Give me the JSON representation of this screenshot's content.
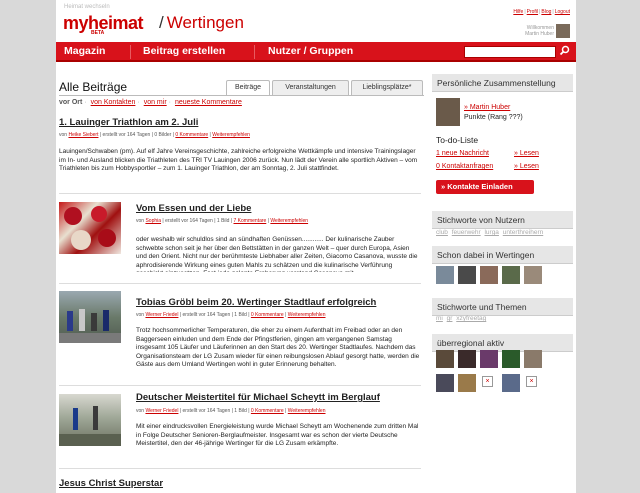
{
  "header": {
    "heimat_switch": "Heimat wechseln",
    "logo": "myheimat",
    "beta": "BETA",
    "city": "Wertingen",
    "toplinks": [
      "Hilfe",
      "Profil",
      "Blog",
      "Logout"
    ],
    "welcome_line1": "Willkommen",
    "welcome_line2": "Martin Huber"
  },
  "nav": {
    "items": [
      "Magazin",
      "Beitrag erstellen",
      "Nutzer / Gruppen"
    ],
    "search_placeholder": ""
  },
  "main": {
    "title": "Alle Beiträge",
    "tabs": [
      "Beiträge",
      "Veranstaltungen",
      "Lieblingsplätze*"
    ],
    "subnav": {
      "current": "vor Ort",
      "links": [
        "von Kontakten",
        "von mir",
        "neueste Kommentare"
      ]
    },
    "articles": [
      {
        "title": "1. Lauinger Triathlon am 2. Juli",
        "meta_pre": "von",
        "author": "Heike Siebert",
        "meta_mid": "| erstellt vor 164 Tagen | 0 Bilder |",
        "comments": "0 Kommentare",
        "recommend": "Weiterempfehlen",
        "text": "Lauingen/Schwaben (pm). Auf elf Jahre Vereinsgeschichte, zahlreiche erfolgreiche Wettkämpfe und intensive Trainingslager im In- und Ausland blicken die Triathleten des TRI TV Lauingen 2006 zurück. Nun lädt der Verein alle sportlich Aktiven – vom Triathleten bis zum Hobbysportler – zum 1. Lauinger Triathlon, der am Sonntag, 2. Juli stattfindet."
      },
      {
        "title": "Vom Essen und der Liebe",
        "meta_pre": "von",
        "author": "Sophia",
        "meta_mid": "| erstellt vor 164 Tagen | 1 Bild |",
        "comments": "7 Kommentare",
        "recommend": "Weiterempfehlen",
        "text": "oder weshalb wir schuldlos sind an sündhaften Genüssen............ Der kulinarische Zauber schwebte schon seit je her über den Bettstätten in der ganzen Welt – quer durch Europa, Asien und den Orient. Nicht nur der berühmteste Liebhaber aller Zeiten, Giacomo Casanova, wusste die aphrodisierende Wirkung eines guten Mahls zu schätzen und die kulinarische Verführung geschickt einzusetzen. Fast jede galante Eroberung verstand Casanova mit ..."
      },
      {
        "title": "Tobias Gröbl beim 20. Wertinger Stadtlauf erfolgreich",
        "meta_pre": "von",
        "author": "Werner Friedel",
        "meta_mid": "| erstellt vor 164 Tagen | 1 Bild |",
        "comments": "0 Kommentare",
        "recommend": "Weiterempfehlen",
        "text": "Trotz hochsommerlicher Temperaturen, die eher zu einem Aufenthalt im Freibad oder an den Baggerseen einluden und dem Ende der Pfingstferien, gingen am vergangenen Samstag insgesamt 105 Läufer und Läuferinnen an den Start des 20. Wertinger Stadtlaufes. Nachdem das Organisationsteam der LG Zusam wieder für einen reibungslosen Ablauf gesorgt hatte, werden die Gäste aus dem Umland Wertingen wohl in guter Erinnerung behalten."
      },
      {
        "title": "Deutscher Meistertitel für Michael Scheytt im Berglauf",
        "meta_pre": "von",
        "author": "Werner Friedel",
        "meta_mid": "| erstellt vor 164 Tagen | 1 Bild |",
        "comments": "0 Kommentare",
        "recommend": "Weiterempfehlen",
        "text": "Mit einer eindrucksvollen Energieleistung wurde Michael Scheytt am Wochenende zum dritten Mal in Folge Deutscher Senioren-Berglaufmeister. Insgesamt war es schon der vierte Deutsche Meistertitel, den der 46-jährige Wertinger für die LG Zusam erkämpfte."
      }
    ],
    "next_title": "Jesus Christ Superstar"
  },
  "sidebar": {
    "personal_title": "Persönliche Zusammenstellung",
    "user_name": "» Martin Huber",
    "points": "Punkte (Rang ???)",
    "todo_title": "To-do-Liste",
    "todo_items": [
      {
        "label": "1 neue Nachricht",
        "action": "» Lesen"
      },
      {
        "label": "0 Kontaktanfragen",
        "action": "» Lesen"
      }
    ],
    "invite_button": "» Kontakte Einladen",
    "tags_users_title": "Stichworte von Nutzern",
    "tags_users": [
      "club",
      "feuerwehr",
      "lurga",
      "unterthreihern"
    ],
    "present_title": "Schon dabei in Wertingen",
    "tags_themes_title": "Stichworte und Themen",
    "tags_themes": [
      "mi",
      "gr",
      "xzyfreetag"
    ],
    "regional_title": "überregional aktiv"
  },
  "colors": {
    "brand": "#d8121b",
    "link": "#cc0000"
  }
}
